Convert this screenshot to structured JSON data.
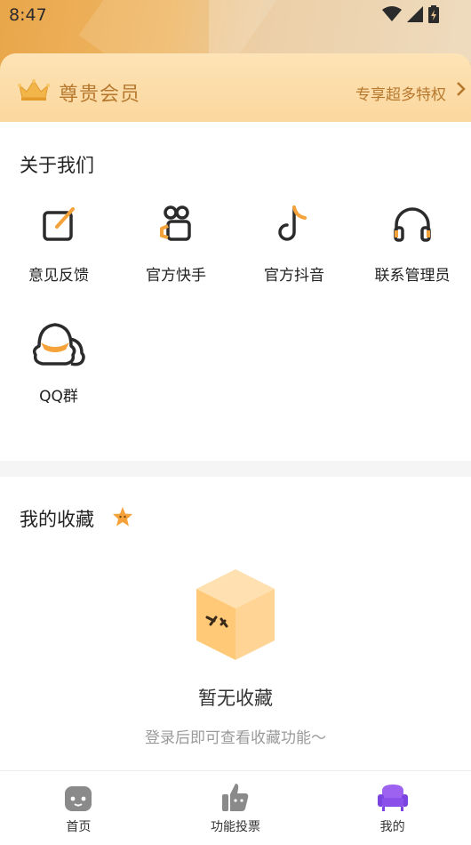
{
  "status_bar": {
    "time": "8:47"
  },
  "vip": {
    "title": "尊贵会员",
    "more": "专享超多特权"
  },
  "about": {
    "title": "关于我们",
    "items": [
      {
        "label": "意见反馈",
        "icon": "feedback-icon"
      },
      {
        "label": "官方快手",
        "icon": "kuaishou-icon"
      },
      {
        "label": "官方抖音",
        "icon": "douyin-icon"
      },
      {
        "label": "联系管理员",
        "icon": "headset-icon"
      },
      {
        "label": "QQ群",
        "icon": "qq-group-icon"
      }
    ]
  },
  "favorites": {
    "title": "我的收藏",
    "empty_title": "暂无收藏",
    "empty_subtitle": "登录后即可查看收藏功能～"
  },
  "nav": {
    "items": [
      {
        "label": "首页",
        "icon": "home-icon"
      },
      {
        "label": "功能投票",
        "icon": "thumbs-up-icon"
      },
      {
        "label": "我的",
        "icon": "sofa-icon"
      }
    ]
  },
  "colors": {
    "accent": "#f6a23a",
    "gold": "#b7792f",
    "vip_bg": "#fcdca6"
  }
}
